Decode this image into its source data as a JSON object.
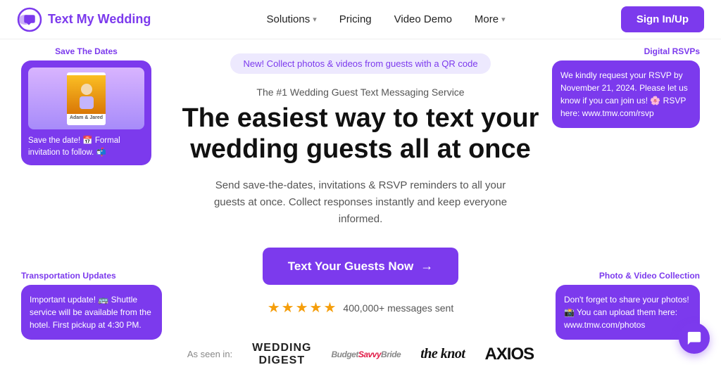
{
  "nav": {
    "logo_text": "Text My Wedding",
    "links": [
      {
        "label": "Solutions",
        "has_chevron": true
      },
      {
        "label": "Pricing",
        "has_chevron": false
      },
      {
        "label": "Video Demo",
        "has_chevron": false
      },
      {
        "label": "More",
        "has_chevron": true
      }
    ],
    "cta_label": "Sign In/Up"
  },
  "hero": {
    "badge": "New! Collect photos & videos from guests with a QR code",
    "subtitle": "The #1 Wedding Guest Text Messaging Service",
    "headline_line1": "The easiest way to text your",
    "headline_line2": "wedding guests all at once",
    "description": "Send save-the-dates, invitations & RSVP reminders to all your guests at once. Collect responses instantly and keep everyone informed.",
    "cta_label": "Text Your Guests Now",
    "stars_count": "★★★★★",
    "messages_sent": "400,000+ messages sent"
  },
  "as_seen_in": {
    "label": "As seen in:",
    "brands": [
      {
        "name": "WEDDING DIGEST",
        "class": "wedding-digest"
      },
      {
        "name": "Budget Savvy Bride",
        "class": "savvy"
      },
      {
        "name": "the knot",
        "class": "knot"
      },
      {
        "name": "AXIOS",
        "class": "axios"
      }
    ]
  },
  "cards": {
    "save_dates": {
      "label": "Save The Dates",
      "photo_names": "Adam & Jared",
      "message": "Save the date! 📅 Formal invitation to follow. 📬"
    },
    "transport": {
      "label": "Transportation Updates",
      "message": "Important update! 🚌 Shuttle service will be available from the hotel. First pickup at 4:30 PM."
    },
    "rsvp": {
      "label": "Digital RSVPs",
      "message": "We kindly request your RSVP by November 21, 2024. Please let us know if you can join us! 🌸 RSVP here: www.tmw.com/rsvp"
    },
    "photo": {
      "label": "Photo & Video Collection",
      "message": "Don't forget to share your photos! 📸 You can upload them here: www.tmw.com/photos"
    }
  }
}
